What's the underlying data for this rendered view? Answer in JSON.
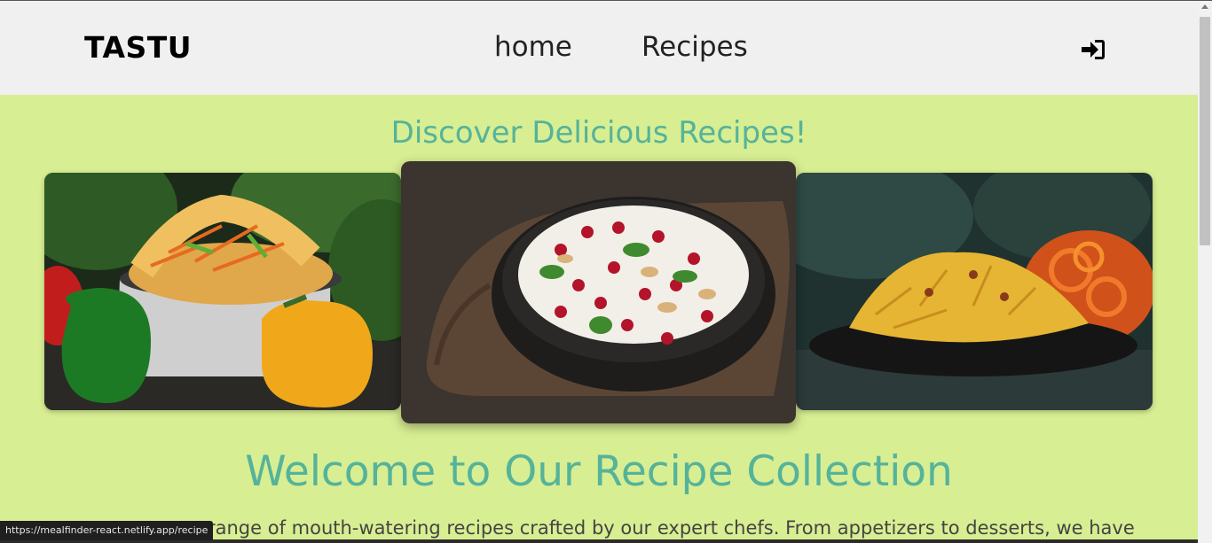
{
  "navbar": {
    "brand": "TASTU",
    "links": [
      {
        "label": "home"
      },
      {
        "label": "Recipes"
      }
    ],
    "login_icon": "sign-in-icon"
  },
  "hero": {
    "title": "Discover Delicious Recipes!",
    "images": [
      {
        "name": "hakka-noodles-with-bell-peppers"
      },
      {
        "name": "curd-rice-with-pomegranate"
      },
      {
        "name": "fafda-jalebi"
      }
    ]
  },
  "welcome": {
    "title": "Welcome to Our Recipe Collection",
    "intro": "range of mouth-watering recipes crafted by our expert chefs. From appetizers to desserts, we have"
  },
  "status": {
    "url": "https://mealfinder-react.netlify.app/recipe"
  },
  "colors": {
    "page_background": "#d8ee92",
    "navbar_background": "#f0f0f0",
    "accent_heading": "#55b39a"
  }
}
